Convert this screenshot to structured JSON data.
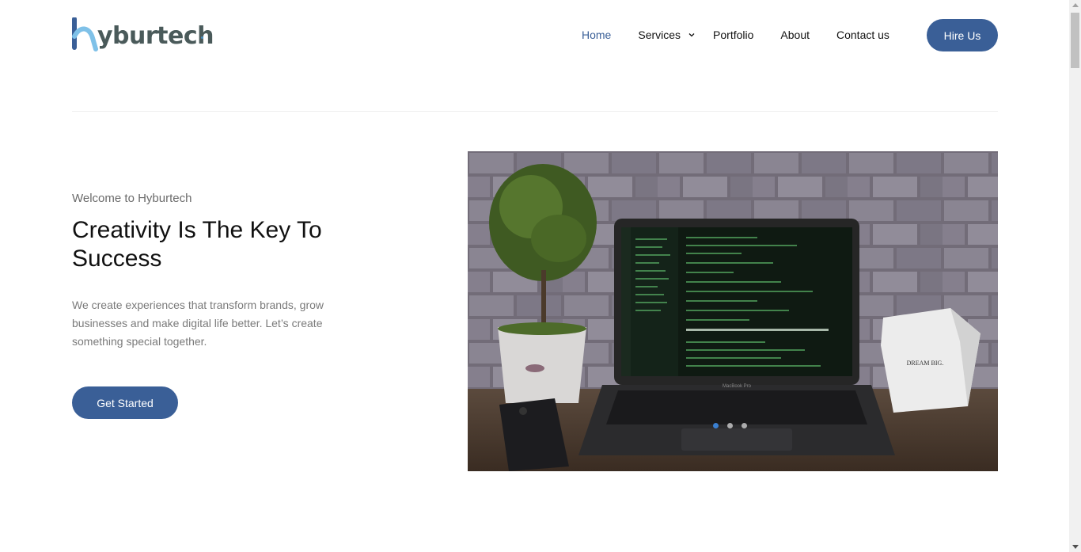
{
  "header": {
    "logo_text": "yburtech",
    "nav": {
      "home": "Home",
      "services": "Services",
      "portfolio": "Portfolio",
      "about": "About",
      "contact": "Contact us"
    },
    "hire_label": "Hire Us"
  },
  "hero": {
    "welcome": "Welcome to Hyburtech",
    "headline": "Creativity Is The Key To Success",
    "description": "We create experiences that transform brands, grow businesses and make digital life better. Let’s create something special together.",
    "cta_label": "Get Started",
    "slider": {
      "slide_count": 3,
      "active_slide": 1
    },
    "image_text": {
      "box_label": "DREAM BIG.",
      "laptop_label": "MacBook Pro"
    }
  },
  "colors": {
    "accent": "#3a5f97",
    "nav_active": "#3a5f97",
    "logo_gray": "#4a5a5a",
    "logo_blue": "#4a90c0"
  },
  "icons": {
    "services_dropdown": "chevron-down-icon",
    "logo_mark": "h-logo-mark"
  }
}
